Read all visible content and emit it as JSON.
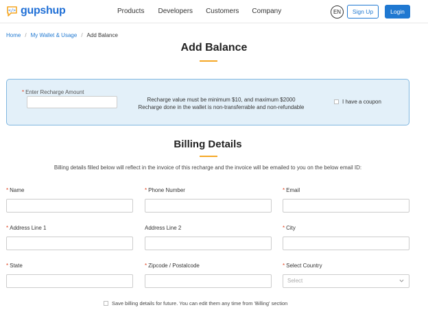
{
  "header": {
    "logo_text": "gupshup",
    "nav": [
      "Products",
      "Developers",
      "Customers",
      "Company"
    ],
    "lang": "EN",
    "signup_label": "Sign Up",
    "login_label": "Login"
  },
  "breadcrumb": {
    "items": [
      "Home",
      "My Wallet & Usage",
      "Add Balance"
    ],
    "separator": "/"
  },
  "page": {
    "title": "Add Balance"
  },
  "recharge": {
    "label": "Enter Recharge Amount",
    "required_mark": "*",
    "amount_value": "",
    "note_line1": "Recharge value must be minimum $10, and maximum $2000",
    "note_line2": "Recharge done in the wallet is non-transferrable and non-refundable",
    "coupon_label": "I have a coupon"
  },
  "billing": {
    "title": "Billing Details",
    "description": "Billing details filled below will reflect in the invoice of this recharge and the invoice will be emailed to you on the below email ID:",
    "fields": {
      "name": {
        "label": "Name",
        "required": "*",
        "value": ""
      },
      "phone": {
        "label": "Phone Number",
        "required": "*",
        "value": ""
      },
      "email": {
        "label": "Email",
        "required": "*",
        "value": ""
      },
      "address1": {
        "label": "Address Line 1",
        "required": "*",
        "value": ""
      },
      "address2": {
        "label": "Address Line 2",
        "required": "",
        "value": ""
      },
      "city": {
        "label": "City",
        "required": "*",
        "value": ""
      },
      "state": {
        "label": "State",
        "required": "*",
        "value": ""
      },
      "zipcode": {
        "label": "Zipcode / Postalcode",
        "required": "*",
        "value": ""
      },
      "country": {
        "label": "Select Country",
        "required": "*",
        "placeholder": "Select"
      }
    },
    "save_label": "Save billing details for future. You can edit them any time from 'Billing' section"
  },
  "colors": {
    "accent": "#1f78d1",
    "underline": "#f5a623",
    "required": "#e0401d",
    "recharge_bg": "#e3f0f9"
  }
}
